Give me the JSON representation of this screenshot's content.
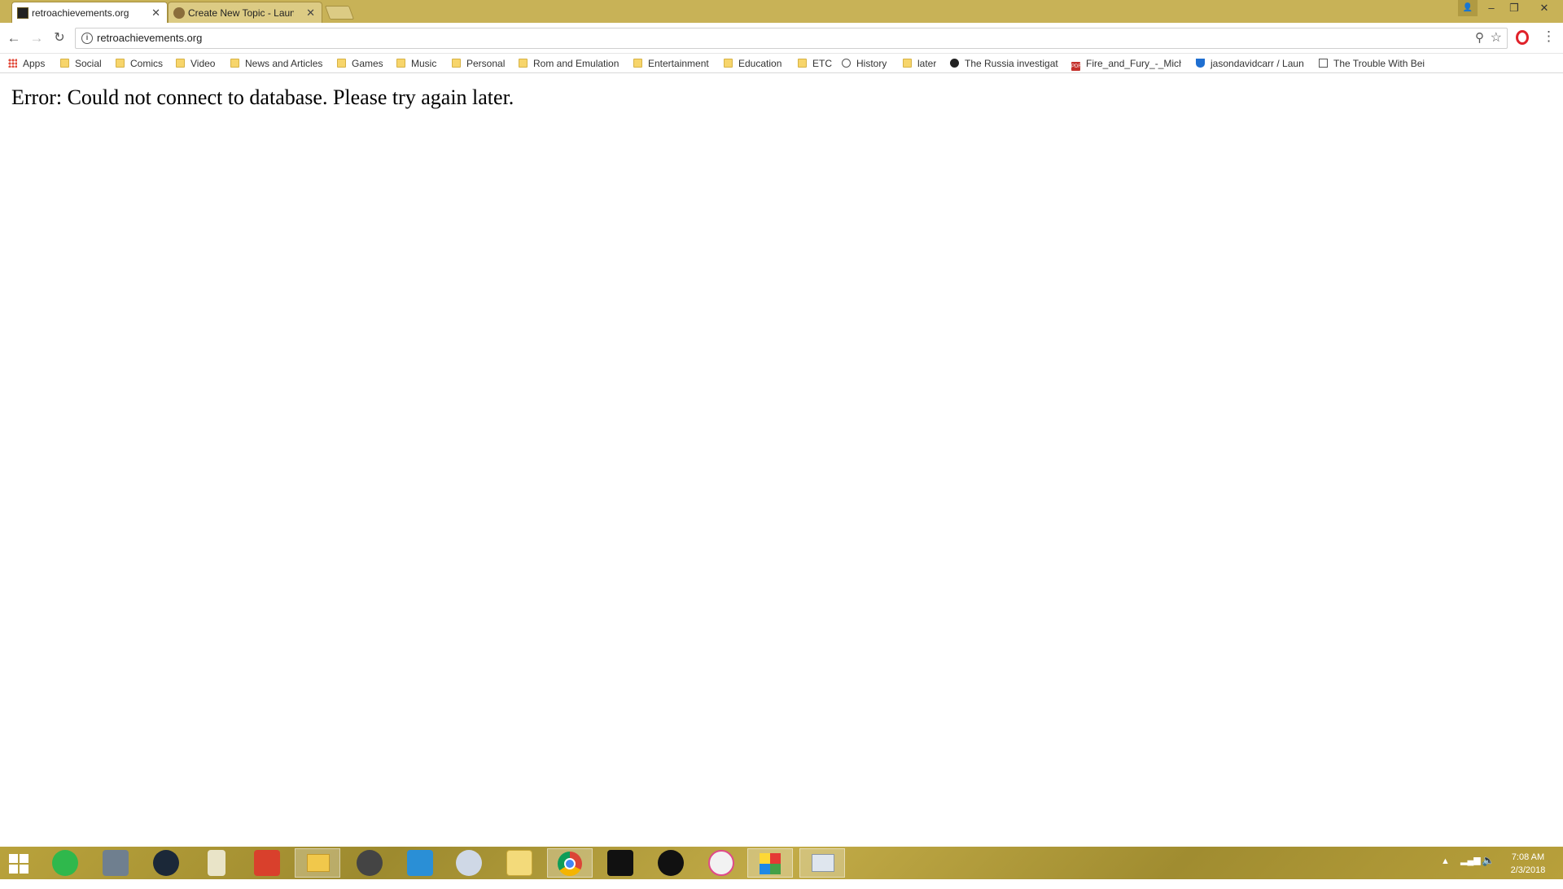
{
  "browser": {
    "tabs": [
      {
        "title": "retroachievements.org",
        "active": true
      },
      {
        "title": "Create New Topic - Laun",
        "active": false
      }
    ],
    "address_bar": {
      "url": "retroachievements.org"
    },
    "bookmarks": [
      {
        "label": "Apps",
        "icon": "apps-grid-icon"
      },
      {
        "label": "Social",
        "icon": "folder-icon"
      },
      {
        "label": "Comics",
        "icon": "folder-icon"
      },
      {
        "label": "Video",
        "icon": "folder-icon"
      },
      {
        "label": "News and Articles",
        "icon": "folder-icon"
      },
      {
        "label": "Games",
        "icon": "folder-icon"
      },
      {
        "label": "Music",
        "icon": "folder-icon"
      },
      {
        "label": "Personal",
        "icon": "folder-icon"
      },
      {
        "label": "Rom and Emulation",
        "icon": "folder-icon"
      },
      {
        "label": "Entertainment",
        "icon": "folder-icon"
      },
      {
        "label": "Education",
        "icon": "folder-icon"
      },
      {
        "label": "ETC",
        "icon": "folder-icon"
      },
      {
        "label": "History",
        "icon": "history-icon"
      },
      {
        "label": "later",
        "icon": "folder-icon"
      },
      {
        "label": "The Russia investigat",
        "icon": "site-icon"
      },
      {
        "label": "Fire_and_Fury_-_Mich",
        "icon": "pdf-icon"
      },
      {
        "label": "jasondavidcarr / Laun",
        "icon": "shield-icon"
      },
      {
        "label": "The Trouble With Bei",
        "icon": "page-icon"
      }
    ]
  },
  "page": {
    "error_message": "Error: Could not connect to database. Please try again later."
  },
  "taskbar": {
    "clock_time": "7:08 AM",
    "clock_date": "2/3/2018"
  },
  "colors": {
    "titlebar": "#c8b257",
    "taskbar": "#b09a3a",
    "folder": "#f7d56b"
  }
}
